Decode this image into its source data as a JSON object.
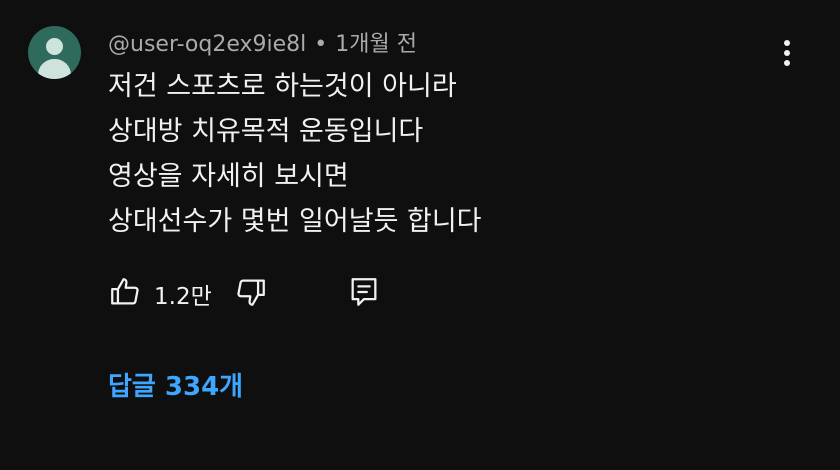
{
  "comment": {
    "author": "@user-oq2ex9ie8l",
    "separator": "•",
    "time": "1개월 전",
    "lines": [
      "저건 스포츠로 하는것이 아니라",
      "상대방 치유목적 운동입니다",
      "영상을 자세히 보시면",
      "상대선수가 몇번 일어날듯 합니다"
    ]
  },
  "actions": {
    "like_count": "1.2만"
  },
  "replies": {
    "label": "답글 334개"
  },
  "colors": {
    "background": "#0f0f0f",
    "text": "#f1f1f1",
    "meta": "#aaaaaa",
    "link": "#3ea6ff",
    "avatar": "#2f6b5c"
  },
  "icons": [
    "avatar-default",
    "more-vert-icon",
    "thumb-up-icon",
    "thumb-down-icon",
    "reply-comment-icon"
  ]
}
